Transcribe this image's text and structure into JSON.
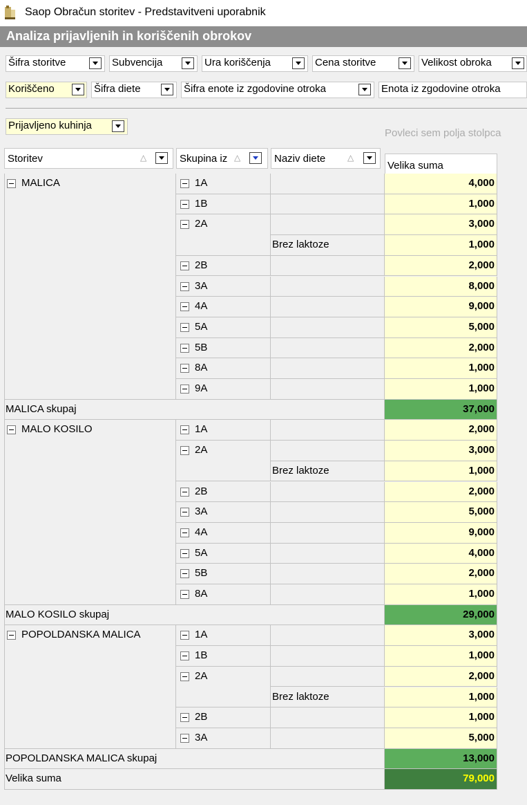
{
  "window": {
    "title": "Saop Obračun storitev - Predstavitveni uporabnik",
    "header": "Analiza prijavljenih in koriščenih obrokov"
  },
  "filter_fields": [
    {
      "label": "Šifra storitve"
    },
    {
      "label": "Subvencija"
    },
    {
      "label": "Ura koriščenja"
    },
    {
      "label": "Cena storitve"
    },
    {
      "label": "Velikost obroka"
    },
    {
      "label": "Koriščeno"
    },
    {
      "label": "Šifra diete"
    },
    {
      "label": "Šifra enote iz zgodovine otroka"
    },
    {
      "label": "Enota iz zgodovine otroka"
    }
  ],
  "data_field": {
    "label": "Prijavljeno kuhinja"
  },
  "column_drop_hint": "Povleci sem polja stolpca",
  "row_headers": [
    {
      "label": "Storitev"
    },
    {
      "label": "Skupina iz"
    },
    {
      "label": "Naziv diete"
    }
  ],
  "value_header": "Velika suma",
  "groups": [
    {
      "name": "MALICA",
      "rows": [
        {
          "skupina": "1A",
          "dieta": "",
          "value": "4,000"
        },
        {
          "skupina": "1B",
          "dieta": "",
          "value": "1,000"
        },
        {
          "skupina": "2A",
          "dieta": "",
          "value": "3,000"
        },
        {
          "skupina": "",
          "dieta": "Brez laktoze",
          "value": "1,000"
        },
        {
          "skupina": "2B",
          "dieta": "",
          "value": "2,000"
        },
        {
          "skupina": "3A",
          "dieta": "",
          "value": "8,000"
        },
        {
          "skupina": "4A",
          "dieta": "",
          "value": "9,000"
        },
        {
          "skupina": "5A",
          "dieta": "",
          "value": "5,000"
        },
        {
          "skupina": "5B",
          "dieta": "",
          "value": "2,000"
        },
        {
          "skupina": "8A",
          "dieta": "",
          "value": "1,000"
        },
        {
          "skupina": "9A",
          "dieta": "",
          "value": "1,000"
        }
      ],
      "total_label": "MALICA skupaj",
      "total_value": "37,000"
    },
    {
      "name": "MALO KOSILO",
      "rows": [
        {
          "skupina": "1A",
          "dieta": "",
          "value": "2,000"
        },
        {
          "skupina": "2A",
          "dieta": "",
          "value": "3,000"
        },
        {
          "skupina": "",
          "dieta": "Brez laktoze",
          "value": "1,000"
        },
        {
          "skupina": "2B",
          "dieta": "",
          "value": "2,000"
        },
        {
          "skupina": "3A",
          "dieta": "",
          "value": "5,000"
        },
        {
          "skupina": "4A",
          "dieta": "",
          "value": "9,000"
        },
        {
          "skupina": "5A",
          "dieta": "",
          "value": "4,000"
        },
        {
          "skupina": "5B",
          "dieta": "",
          "value": "2,000"
        },
        {
          "skupina": "8A",
          "dieta": "",
          "value": "1,000"
        }
      ],
      "total_label": "MALO KOSILO skupaj",
      "total_value": "29,000"
    },
    {
      "name": "POPOLDANSKA MALICA",
      "rows": [
        {
          "skupina": "1A",
          "dieta": "",
          "value": "3,000"
        },
        {
          "skupina": "1B",
          "dieta": "",
          "value": "1,000"
        },
        {
          "skupina": "2A",
          "dieta": "",
          "value": "2,000"
        },
        {
          "skupina": "",
          "dieta": "Brez laktoze",
          "value": "1,000"
        },
        {
          "skupina": "2B",
          "dieta": "",
          "value": "1,000"
        },
        {
          "skupina": "3A",
          "dieta": "",
          "value": "5,000"
        }
      ],
      "total_label": "POPOLDANSKA MALICA skupaj",
      "total_value": "13,000"
    }
  ],
  "grand_total_label": "Velika suma",
  "grand_total_value": "79,000",
  "colors": {
    "header_bg": "#8e8e8e",
    "value_cell_bg": "#ffffd3",
    "subtotal_bg": "#5cae5c",
    "grand_total_bg": "#3f7f3f",
    "grand_total_text": "#ffff00",
    "active_field_bg": "#ffffd6"
  }
}
